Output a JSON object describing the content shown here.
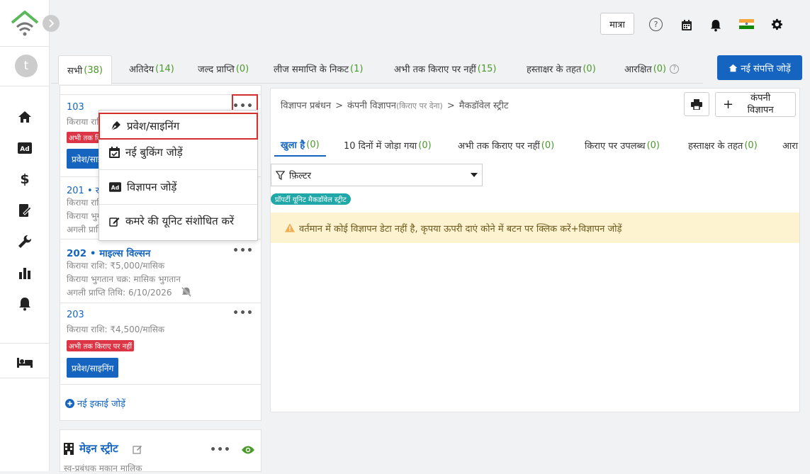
{
  "colors": {
    "accent": "#1565c0",
    "count": "#4a9a2a",
    "badge": "#dc3545",
    "teal": "#20a8a8",
    "warning_bg": "#fdf3d0",
    "logo_green": "#5cb85c"
  },
  "sidebar": {
    "avatar_letter": "t",
    "icons": [
      "home-icon",
      "ad-icon",
      "dollar-icon",
      "contract-icon",
      "wrench-icon",
      "bar-chart-icon",
      "bell-icon",
      "bed-icon"
    ]
  },
  "topbar": {
    "quantity_label": "मात्रा"
  },
  "tabs": [
    {
      "label": "सभी",
      "count": "(38)"
    },
    {
      "label": "अतिदेय",
      "count": "(14)"
    },
    {
      "label": "जल्द प्राप्ति",
      "count": "(0)"
    },
    {
      "label": "लीज समाप्ति के निकट",
      "count": "(1)"
    },
    {
      "label": "अभी तक किराए पर नहीं",
      "count": "(15)"
    },
    {
      "label": "हस्ताक्षर के तहत",
      "count": "(0)"
    },
    {
      "label": "आरक्षित",
      "count": "(0)"
    }
  ],
  "add_property_label": "नई संपत्ति जोड़ें",
  "units": [
    {
      "title": "103",
      "rent": "किराया राशि: ₹...",
      "badge": "अभी तक किराए पर नहीं",
      "button": "प्रवेश/साइनिंग"
    },
    {
      "title": "201 • रा...",
      "rent": "किराया राशि: ₹...",
      "cycle": "किराया भुगतान चक्र: ...",
      "next": "अगली प्राप्ति तिथि: ..."
    },
    {
      "title": "202 • माइल्स विल्सन",
      "rent": "किराया राशि: ₹5,000/मासिक",
      "cycle": "किराया भुगतान चक्र: मासिक भुगतान",
      "next": "अगली प्राप्ति तिथि:  6/10/2026"
    },
    {
      "title": "203",
      "rent": "किराया राशि: ₹4,500/मासिक",
      "badge": "अभी तक किराए पर नहीं",
      "button": "प्रवेश/साइनिंग"
    }
  ],
  "add_unit_label": "नई इकाई जोड़ें",
  "property2": {
    "name": "मेइन स्ट्रीट",
    "subtitle": "स्व-प्रबंधक मकान मालिक"
  },
  "menu": {
    "items": [
      "प्रवेश/साइनिंग",
      "नई बुकिंग जोड़ें",
      "विज्ञापन जोड़ें",
      "कमरे की यूनिट संशोधित करें"
    ]
  },
  "breadcrumb": {
    "part1": "विज्ञापन प्रबंधन",
    "sep": ">",
    "part2": "कंपनी विज्ञापन",
    "part2_sub": "(किराए पर देना)",
    "part3": "मैकडॉवेल स्ट्रीट"
  },
  "company_ad_label": "कंपनी विज्ञापन",
  "subtabs": [
    {
      "label": "खुला है",
      "count": "(0)"
    },
    {
      "label": "10 दिनों में जोड़ा गया",
      "count": "(0)"
    },
    {
      "label": "अभी तक किराए पर नहीं",
      "count": "(0)"
    },
    {
      "label": "किराए पर उपलब्ध",
      "count": "(0)"
    },
    {
      "label": "हस्ताक्षर के तहत",
      "count": "(0)"
    },
    {
      "label": "आरा",
      "count": ""
    }
  ],
  "filter_label": "फ़िल्टर",
  "tag_label": "प्रॉपर्टी यूनिट मैकडॉवेल स्ट्रीट",
  "warning_text": "वर्तमान में कोई विज्ञापन डेटा नहीं है, कृपया ऊपरी दाएं कोने में बटन पर क्लिक करें+विज्ञापन जोड़ें"
}
